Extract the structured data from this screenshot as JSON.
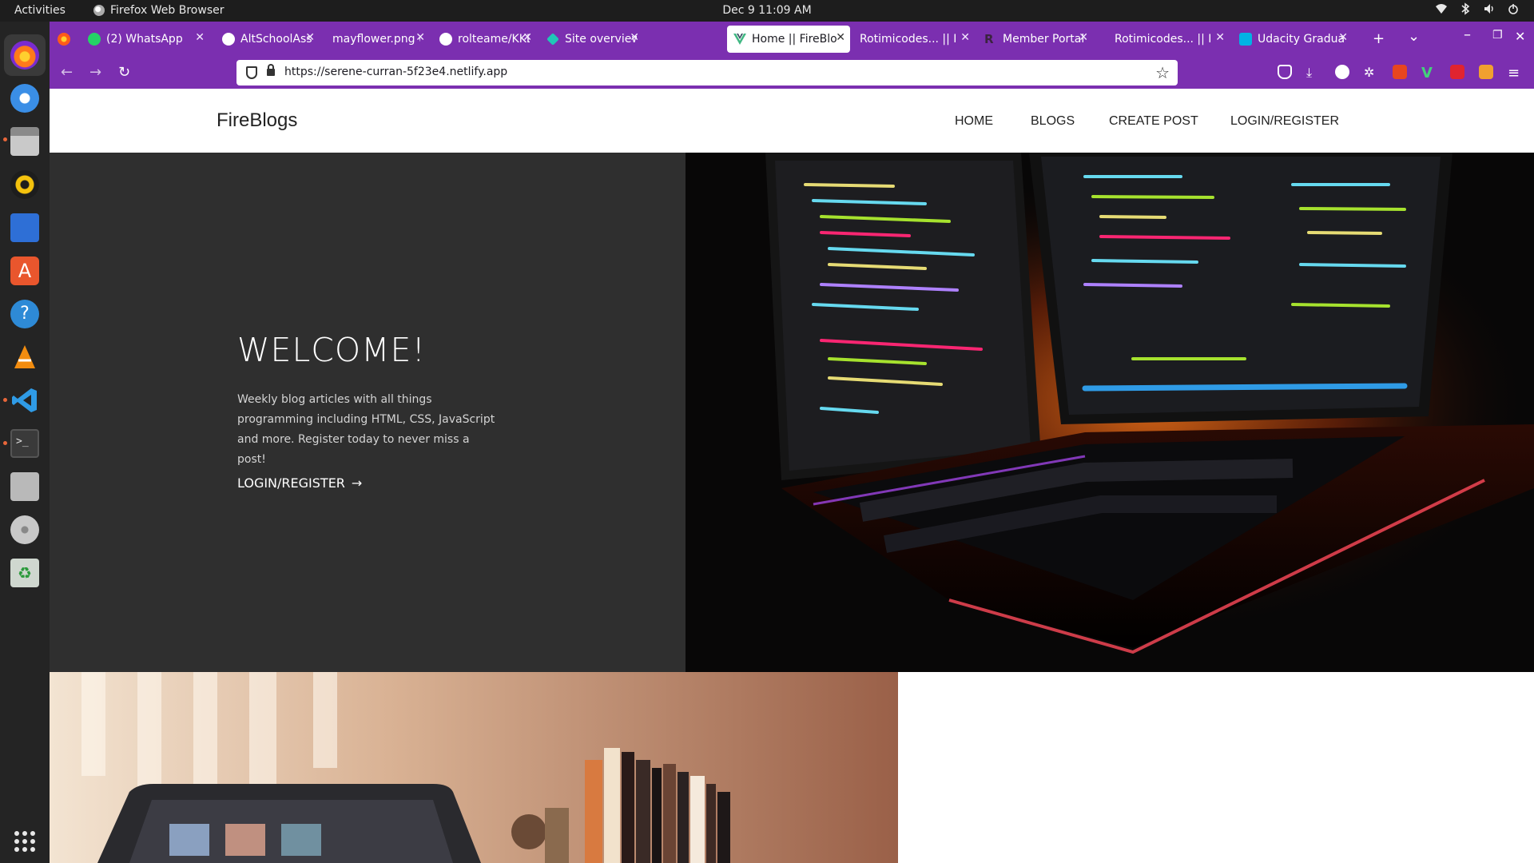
{
  "system": {
    "activities": "Activities",
    "app_name": "Firefox Web Browser",
    "clock": "Dec 9  11:09 AM"
  },
  "tabs": [
    {
      "label": "(2) WhatsApp",
      "icon": "whatsapp-icon",
      "color": "#25d366"
    },
    {
      "label": "AltSchoolAssign",
      "icon": "github-icon",
      "color": "#ffffff"
    },
    {
      "label": "mayflower.png (PN",
      "icon": "image-icon",
      "color": "#7b2fb0"
    },
    {
      "label": "rolteame/KKL:",
      "icon": "github-icon",
      "color": "#ffffff"
    },
    {
      "label": "Site overview |",
      "icon": "netlify-icon",
      "color": "#20c6b7"
    },
    {
      "label": "Home || FireBlo",
      "icon": "vue-icon",
      "color": "#41b883"
    },
    {
      "label": "Rotimicodes... || Ho",
      "icon": "page-icon",
      "color": "#7b2fb0"
    },
    {
      "label": "Member Portal",
      "icon": "r-icon",
      "color": "#4a2a5a"
    },
    {
      "label": "Rotimicodes... || Pr",
      "icon": "page-icon",
      "color": "#7b2fb0"
    },
    {
      "label": "Udacity Gradua",
      "icon": "udacity-icon",
      "color": "#02b3e4"
    }
  ],
  "browser": {
    "url": "https://serene-curran-5f23e4.netlify.app",
    "new_tab": "+",
    "tab_list": "⌄"
  },
  "site": {
    "brand": "FireBlogs",
    "nav": [
      "HOME",
      "BLOGS",
      "CREATE POST",
      "LOGIN/REGISTER"
    ],
    "hero": {
      "title": "WELCOME!",
      "text": "Weekly blog articles with all things programming including HTML, CSS, JavaScript and more. Register today to never miss a post!",
      "cta": "LOGIN/REGISTER",
      "cta_arrow": "→"
    }
  },
  "colors": {
    "firefox_purple": "#7b2fb0",
    "hero_dark": "#2f2f2f",
    "dock_bg": "#242424"
  }
}
